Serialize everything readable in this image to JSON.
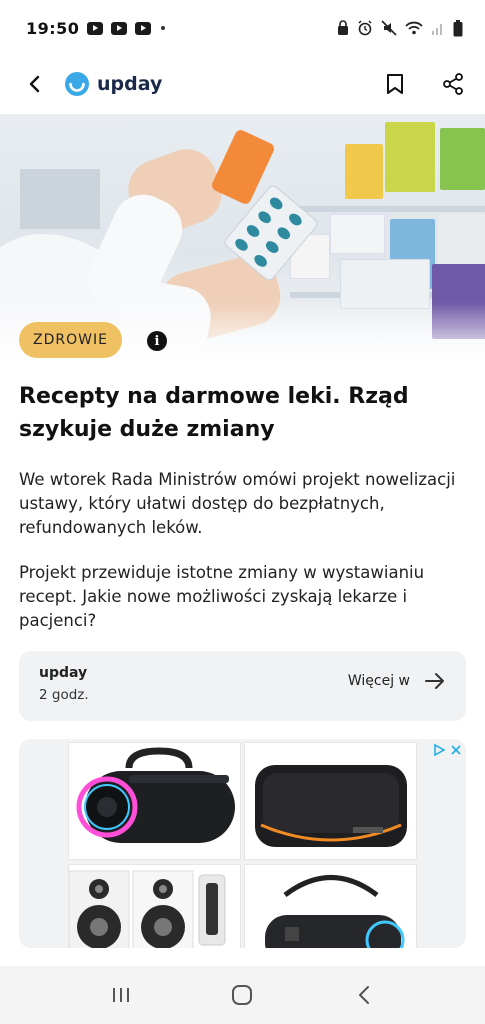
{
  "status_bar": {
    "time": "19:50",
    "notification_icons": [
      "youtube-icon",
      "youtube-icon",
      "youtube-icon"
    ],
    "right_icons": [
      "alarm-icon",
      "mute-icon",
      "wifi-icon",
      "signal-icon",
      "battery-icon"
    ]
  },
  "app_bar": {
    "brand": "upday",
    "brand_color": "#3aa8e6",
    "actions": [
      "bookmark-icon",
      "share-icon"
    ]
  },
  "article": {
    "category": "ZDROWIE",
    "category_color": "#f0c163",
    "title": "Recepty na darmowe leki. Rząd szykuje duże zmiany",
    "lead": "We wtorek Rada Ministrów omówi projekt nowelizacji ustawy, który ułatwi dostęp do bezpłatnych, refundowanych leków.",
    "lead_second": "Projekt przewiduje istotne zmiany w wystawianiu recept. Jakie nowe możliwości zyskają lekarze i pacjenci?"
  },
  "source": {
    "name": "upday",
    "time_ago": "2 godz.",
    "more_label": "Więcej w"
  },
  "ad": {
    "tiles": [
      "speaker-rgb",
      "speaker-black",
      "speakers-white",
      "speaker-portable"
    ]
  },
  "nav_bar": {
    "buttons": [
      "recents-icon",
      "home-icon",
      "back-icon"
    ]
  }
}
